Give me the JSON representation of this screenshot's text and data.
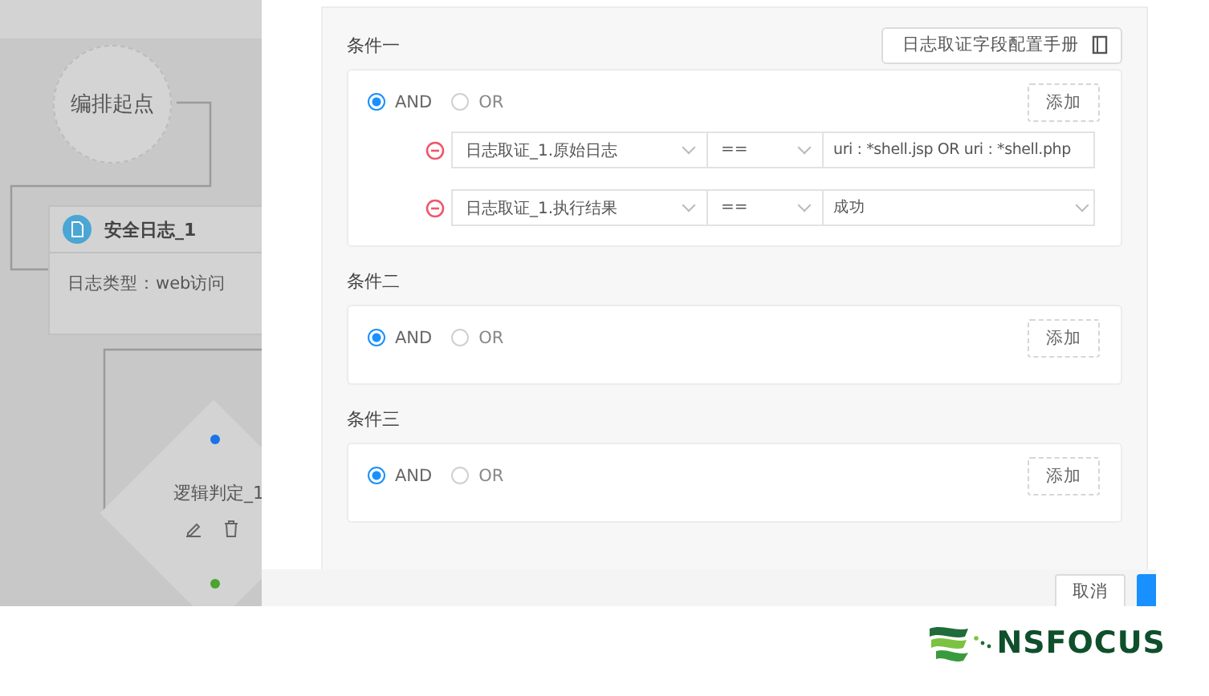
{
  "canvas": {
    "nodes": [
      {
        "kind": "start",
        "label": "编排起点"
      },
      {
        "kind": "log",
        "title": "安全日志_1",
        "detail": "日志类型：web访问"
      },
      {
        "kind": "decision",
        "label": "逻辑判定_1"
      }
    ]
  },
  "manual_button": "日志取证字段配置手册",
  "conditions": [
    {
      "title": "条件一",
      "options": [
        {
          "label": "AND",
          "selected": true
        },
        {
          "label": "OR",
          "selected": false
        }
      ],
      "add_button": "添加",
      "rules": [
        {
          "field": "日志取证_1.原始日志",
          "operator": "==",
          "value": "uri : *shell.jsp OR uri : *shell.php",
          "kind": "input"
        },
        {
          "field": "日志取证_1.执行结果",
          "operator": "==",
          "value": "成功",
          "kind": "select"
        }
      ]
    },
    {
      "title": "条件二",
      "options": [
        {
          "label": "AND",
          "selected": true
        },
        {
          "label": "OR",
          "selected": false
        }
      ],
      "add_button": "添加"
    },
    {
      "title": "条件三",
      "options": [
        {
          "label": "AND",
          "selected": true
        },
        {
          "label": "OR",
          "selected": false
        }
      ],
      "add_button": "添加"
    }
  ],
  "footer": {
    "cancel": "取消"
  },
  "logo": {
    "text": "NSFOCUS"
  }
}
